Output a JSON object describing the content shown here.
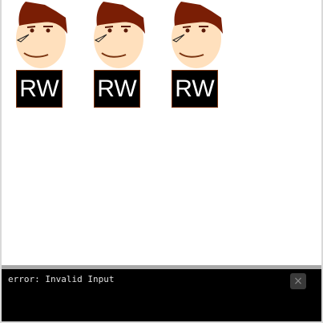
{
  "sprites": [
    {
      "label": "RW"
    },
    {
      "label": "RW"
    },
    {
      "label": "RW"
    }
  ],
  "console": {
    "message": "error: Invalid Input",
    "close_symbol": "×"
  },
  "colors": {
    "hair": "#7a1e05",
    "skin": "#ffe0bd",
    "card": "#000000",
    "console_bg": "#000000",
    "console_bar": "#a9a9a9"
  }
}
